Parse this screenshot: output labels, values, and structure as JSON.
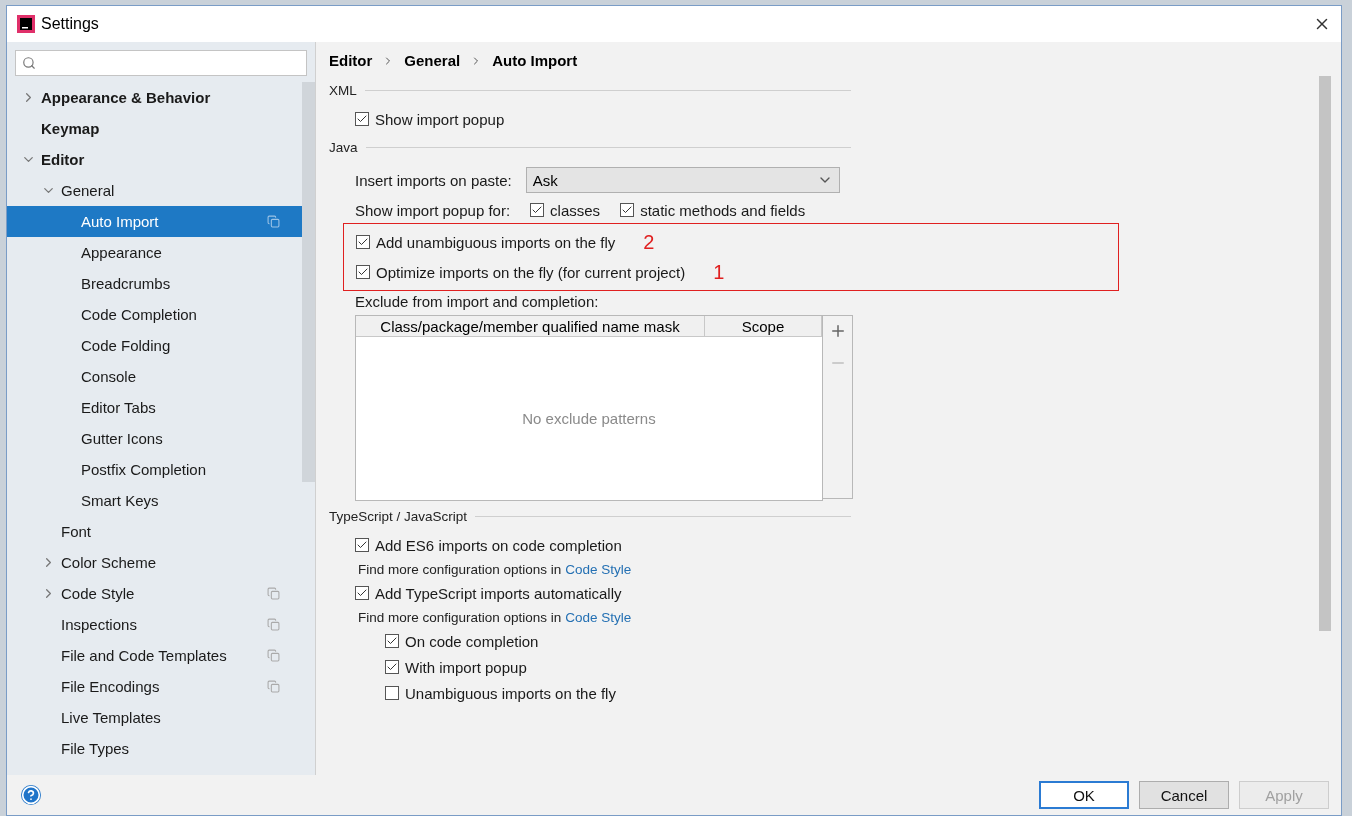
{
  "window": {
    "title": "Settings"
  },
  "sidebar": {
    "items": [
      {
        "label": "Appearance & Behavior",
        "expanded": false,
        "selected": false
      },
      {
        "label": "Keymap",
        "selected": false
      },
      {
        "label": "Editor",
        "expanded": true,
        "selected": false,
        "children": [
          {
            "label": "General",
            "expanded": true,
            "selected": false,
            "children": [
              {
                "label": "Auto Import",
                "selected": true,
                "project_scoped": true
              },
              {
                "label": "Appearance",
                "selected": false
              },
              {
                "label": "Breadcrumbs",
                "selected": false
              },
              {
                "label": "Code Completion",
                "selected": false
              },
              {
                "label": "Code Folding",
                "selected": false
              },
              {
                "label": "Console",
                "selected": false
              },
              {
                "label": "Editor Tabs",
                "selected": false
              },
              {
                "label": "Gutter Icons",
                "selected": false
              },
              {
                "label": "Postfix Completion",
                "selected": false
              },
              {
                "label": "Smart Keys",
                "selected": false
              }
            ]
          },
          {
            "label": "Font",
            "selected": false
          },
          {
            "label": "Color Scheme",
            "expanded": false,
            "selected": false
          },
          {
            "label": "Code Style",
            "expanded": false,
            "selected": false,
            "project_scoped": true
          },
          {
            "label": "Inspections",
            "selected": false,
            "project_scoped": true
          },
          {
            "label": "File and Code Templates",
            "selected": false,
            "project_scoped": true
          },
          {
            "label": "File Encodings",
            "selected": false,
            "project_scoped": true
          },
          {
            "label": "Live Templates",
            "selected": false
          },
          {
            "label": "File Types",
            "selected": false
          }
        ]
      }
    ]
  },
  "breadcrumb": [
    "Editor",
    "General",
    "Auto Import"
  ],
  "sections": [
    {
      "title": "XML",
      "rows": [
        {
          "kind": "checkbox",
          "label": "Show import popup",
          "checked": true
        }
      ]
    },
    {
      "title": "Java",
      "rows": [
        {
          "kind": "dropdown",
          "label": "Insert imports on paste:",
          "value": "Ask"
        },
        {
          "kind": "checkgroup",
          "label": "Show import popup for:",
          "options": [
            {
              "label": "classes",
              "checked": true
            },
            {
              "label": "static methods and fields",
              "checked": true
            }
          ]
        },
        {
          "kind": "highlight",
          "items": [
            {
              "label": "Add unambiguous imports on the fly",
              "checked": true,
              "note": "2"
            },
            {
              "label": "Optimize imports on the fly (for current project)",
              "checked": true,
              "note": "1"
            }
          ]
        },
        {
          "kind": "table",
          "label": "Exclude from import and completion:",
          "columns": [
            "Class/package/member qualified name mask",
            "Scope"
          ],
          "empty_text": "No exclude patterns",
          "tools": [
            {
              "kind": "add",
              "disabled": false
            },
            {
              "kind": "remove",
              "disabled": true
            }
          ]
        }
      ]
    },
    {
      "title": "TypeScript / JavaScript",
      "rows": [
        {
          "kind": "checkbox",
          "label": "Add ES6 imports on code completion",
          "checked": true
        },
        {
          "kind": "hint",
          "text": "Find more configuration options in",
          "link": "Code Style"
        },
        {
          "kind": "checkbox",
          "label": "Add TypeScript imports automatically",
          "checked": true
        },
        {
          "kind": "hint",
          "text": "Find more configuration options in",
          "link": "Code Style"
        },
        {
          "kind": "checkbox",
          "label": "On code completion",
          "checked": true,
          "indented": true
        },
        {
          "kind": "checkbox",
          "label": "With import popup",
          "checked": true,
          "indented": true
        },
        {
          "kind": "checkbox",
          "label": "Unambiguous imports on the fly",
          "checked": false,
          "indented": true
        }
      ]
    }
  ],
  "buttons": [
    {
      "label": "OK",
      "default": true,
      "disabled": false
    },
    {
      "label": "Cancel",
      "default": false,
      "disabled": false
    },
    {
      "label": "Apply",
      "default": false,
      "disabled": true
    }
  ]
}
